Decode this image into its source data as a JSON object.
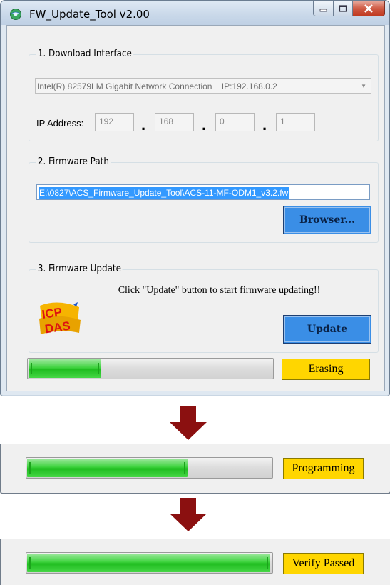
{
  "window": {
    "title": "FW_Update_Tool v2.00"
  },
  "download": {
    "group_label": "1. Download Interface",
    "interface": "Intel(R) 82579LM Gigabit Network Connection    IP:192.168.0.2",
    "ip_label": "IP Address:",
    "ip": [
      "192",
      "168",
      "0",
      "1"
    ],
    "dot": "."
  },
  "firmware_path": {
    "group_label": "2. Firmware Path",
    "path": "E:\\0827\\ACS_Firmware_Update_Tool\\ACS-11-MF-ODM1_v3.2.fw",
    "browse_label": "Browser..."
  },
  "firmware_update": {
    "group_label": "3. Firmware Update",
    "hint": "Click \"Update\" button to start firmware updating!!",
    "update_label": "Update",
    "logo_text": "ICP DAS"
  },
  "stages": [
    {
      "status": "Erasing",
      "progress": 0.3
    },
    {
      "status": "Programming",
      "progress": 0.66
    },
    {
      "status": "Verify Passed",
      "progress": 1.0
    }
  ],
  "colors": {
    "progress_green": "#2cc92c",
    "status_yellow": "#ffd600",
    "button_blue": "#3a8ee6",
    "arrow_red": "#8b1010"
  },
  "icons": [
    "app-globe-icon",
    "minimize-icon",
    "maximize-icon",
    "close-icon",
    "down-arrow-icon",
    "icpdas-logo"
  ]
}
